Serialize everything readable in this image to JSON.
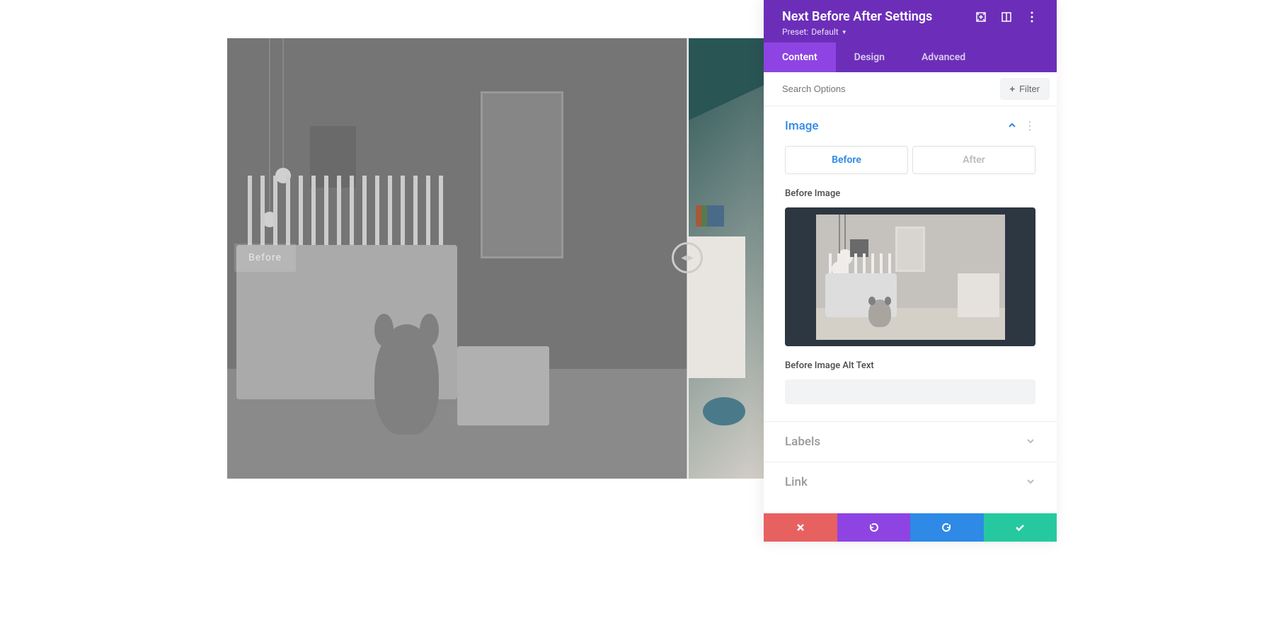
{
  "panel": {
    "title": "Next Before After Settings",
    "preset_label": "Preset:",
    "preset_value": "Default"
  },
  "tabs": {
    "content": "Content",
    "design": "Design",
    "advanced": "Advanced"
  },
  "search": {
    "placeholder": "Search Options",
    "filter_label": "Filter"
  },
  "sections": {
    "image": {
      "title": "Image",
      "toggle_before": "Before",
      "toggle_after": "After",
      "before_image_label": "Before Image",
      "alt_text_label": "Before Image Alt Text",
      "alt_text_value": ""
    },
    "labels": {
      "title": "Labels"
    },
    "link": {
      "title": "Link"
    }
  },
  "preview": {
    "before_label": "Before"
  }
}
